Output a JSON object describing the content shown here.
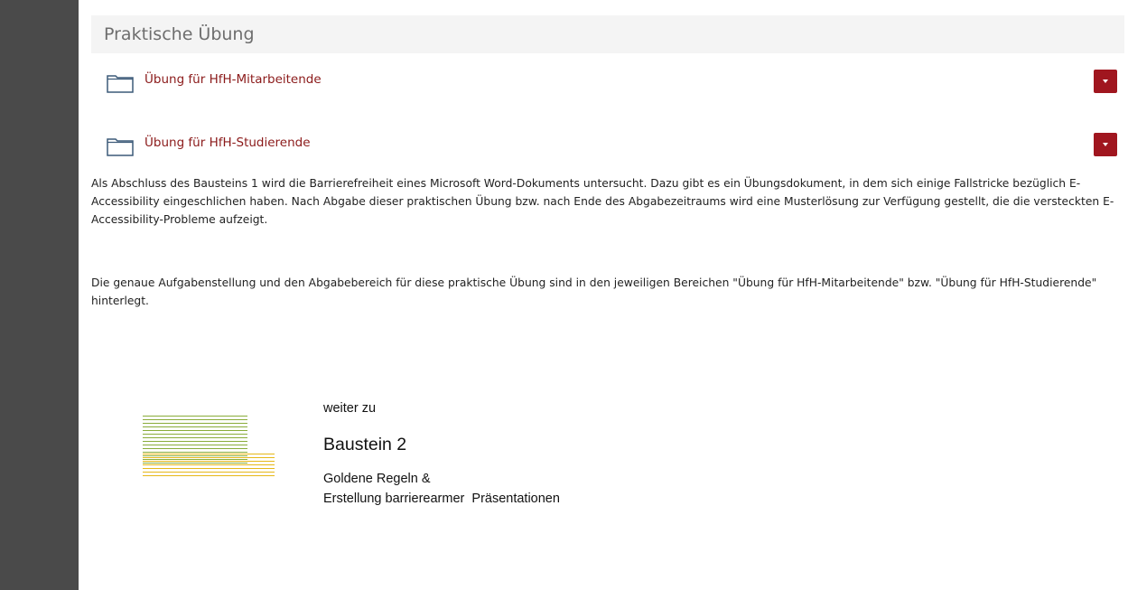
{
  "section": {
    "title": "Praktische Übung"
  },
  "folders": [
    {
      "label": "Übung für HfH-Mitarbeitende",
      "icon": "folder-icon"
    },
    {
      "label": "Übung für HfH-Studierende",
      "icon": "folder-icon"
    }
  ],
  "description": {
    "paragraph1": "Als Abschluss des Bausteins 1 wird die Barrierefreiheit eines Microsoft Word-Dokuments untersucht. Dazu gibt es ein Übungsdokument, in dem sich einige Fallstricke bezüglich E-Accessibility eingeschlichen haben. Nach Abgabe dieser praktischen Übung bzw. nach Ende des Abgabezeitraums wird eine Musterlösung zur Verfügung gestellt, die die versteckten E-Accessibility-Probleme aufzeigt.",
    "paragraph2": "Die genaue Aufgabenstellung und den Abgabebereich für diese praktische Übung sind in den jeweiligen Bereichen \"Übung für HfH-Mitarbeitende\" bzw. \"Übung für HfH-Studierende\" hinterlegt."
  },
  "next": {
    "prefix": "weiter zu",
    "title": "Baustein 2",
    "subtitle_line1": "Goldene Regeln &",
    "subtitle_line2": "Erstellung barrierearmer  Präsentationen",
    "graphic": "striped-lines-graphic"
  },
  "colors": {
    "link": "#8b1a1a",
    "menu_button": "#a0161f",
    "rail": "#4a4a4a",
    "stripe_green": "#8aac3a",
    "stripe_yellow": "#e6b818"
  }
}
